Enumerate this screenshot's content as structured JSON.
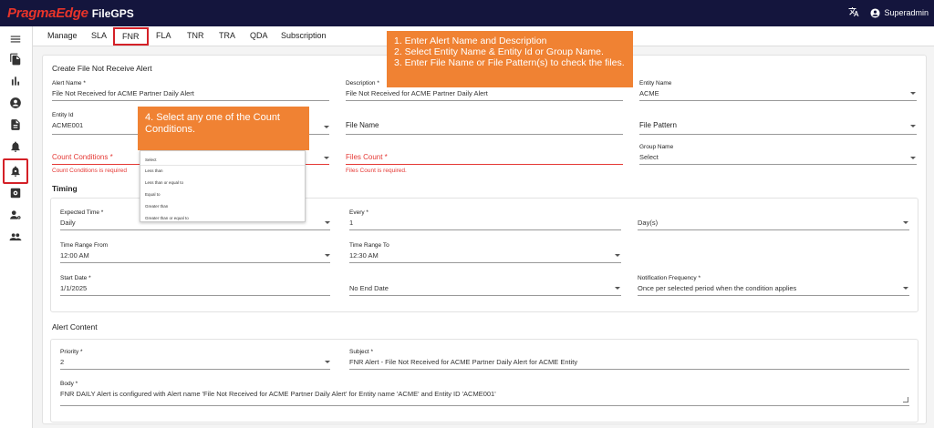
{
  "header": {
    "brand_part1": "PragmaEdge",
    "app_name": "FileGPS",
    "user": "Superadmin",
    "translate_icon": "translate-icon",
    "user_icon": "account-circle-icon",
    "bg_color": "#14153d",
    "brand_color": "#e8342a"
  },
  "sidebar": {
    "icons": [
      "menu-icon",
      "files-icon",
      "chart-icon",
      "account-icon",
      "document-icon",
      "bell-icon",
      "bell-active-icon",
      "settings-box-icon",
      "user-settings-icon",
      "group-icon"
    ]
  },
  "tabs": [
    "Manage",
    "SLA",
    "FNR",
    "FLA",
    "TNR",
    "TRA",
    "QDA",
    "Subscription"
  ],
  "active_tab": "FNR",
  "form": {
    "title": "Create File Not Receive Alert",
    "alert_name_label": "Alert Name *",
    "alert_name_value": "File Not Received for ACME Partner Daily Alert",
    "description_label": "Description *",
    "description_value": "File Not Received for ACME Partner Daily Alert",
    "entity_name_label": "Entity Name",
    "entity_name_value": "ACME",
    "entity_id_label": "Entity Id",
    "entity_id_value": "ACME001",
    "file_name_label": "File Name",
    "file_pattern_label": "File Pattern",
    "count_conditions_label": "Count Conditions *",
    "count_conditions_error": "Count Conditions is required",
    "files_count_label": "Files Count *",
    "files_count_error": "Files Count is required.",
    "group_name_label": "Group Name",
    "group_name_value": "Select"
  },
  "timing": {
    "title": "Timing",
    "expected_time_label": "Expected Time *",
    "expected_time_value": "Daily",
    "every_label": "Every *",
    "every_value": "1",
    "period_value": "Day(s)",
    "time_from_label": "Time Range From",
    "time_from_value": "12:00 AM",
    "time_to_label": "Time Range To",
    "time_to_value": "12:30 AM",
    "start_date_label": "Start Date *",
    "start_date_value": "1/1/2025",
    "end_date_value": "No End Date",
    "notif_freq_label": "Notification Frequency *",
    "notif_freq_value": "Once per selected period when the condition applies"
  },
  "alert_content": {
    "title": "Alert Content",
    "priority_label": "Priority *",
    "priority_value": "2",
    "subject_label": "Subject *",
    "subject_value": "FNR Alert - File Not Received for ACME Partner Daily Alert for ACME Entity",
    "body_label": "Body *",
    "body_value": "FNR DAILY Alert is configured with Alert name 'File Not Received for ACME Partner Daily Alert' for Entity name 'ACME' and Entity ID 'ACME001'"
  },
  "dropdown": {
    "options": [
      "Select",
      "Less than",
      "Less than or equal to",
      "Equal to",
      "Greater than",
      "Greater than or equal to"
    ]
  },
  "callouts": {
    "top": [
      "1. Enter Alert Name and Description",
      "2. Select Entity Name & Entity Id or Group Name.",
      "3. Enter File Name or File Pattern(s) to check the files."
    ],
    "left": "4. Select any one of the Count Conditions.",
    "color": "#f08233"
  },
  "highlight_color": "#d42027",
  "error_color": "#e53935"
}
